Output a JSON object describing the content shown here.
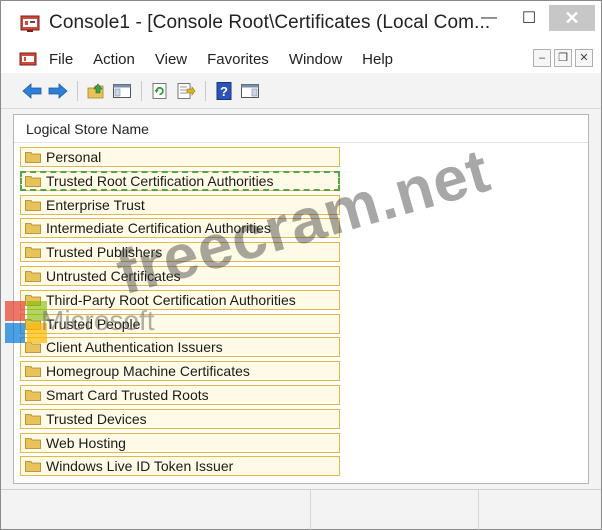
{
  "window": {
    "title": "Console1 - [Console Root\\Certificates (Local Com...",
    "buttons": {
      "minimize": "—",
      "maximize": "☐",
      "close": "✕"
    },
    "accent_close": "#c7c7c7"
  },
  "menu": {
    "items": [
      "File",
      "Action",
      "View",
      "Favorites",
      "Window",
      "Help"
    ],
    "mdi": {
      "minimize": "–",
      "restore": "❐",
      "close": "✕"
    }
  },
  "toolbar": {
    "icons": [
      "back-arrow-icon",
      "forward-arrow-icon",
      "up-folder-icon",
      "show-hide-console-tree-icon",
      "refresh-icon",
      "export-list-icon",
      "help-icon",
      "show-hide-action-pane-icon"
    ]
  },
  "content": {
    "column_header": "Logical Store Name",
    "stores": [
      "Personal",
      "Trusted Root Certification Authorities",
      "Enterprise Trust",
      "Intermediate Certification Authorities",
      "Trusted Publishers",
      "Untrusted Certificates",
      "Third-Party Root Certification Authorities",
      "Trusted People",
      "Client Authentication Issuers",
      "Homegroup Machine Certificates",
      "Smart Card Trusted Roots",
      "Trusted Devices",
      "Web Hosting",
      "Windows Live ID Token Issuer"
    ],
    "focused_index": 1
  },
  "watermark": {
    "site": "freecram.net",
    "logo_text": "Microsoft"
  },
  "colors": {
    "folder": "#e8c25a",
    "item_border": "#e1b84a",
    "focus_dash": "#56a34a",
    "nav_arrow": "#2e7fd6"
  }
}
